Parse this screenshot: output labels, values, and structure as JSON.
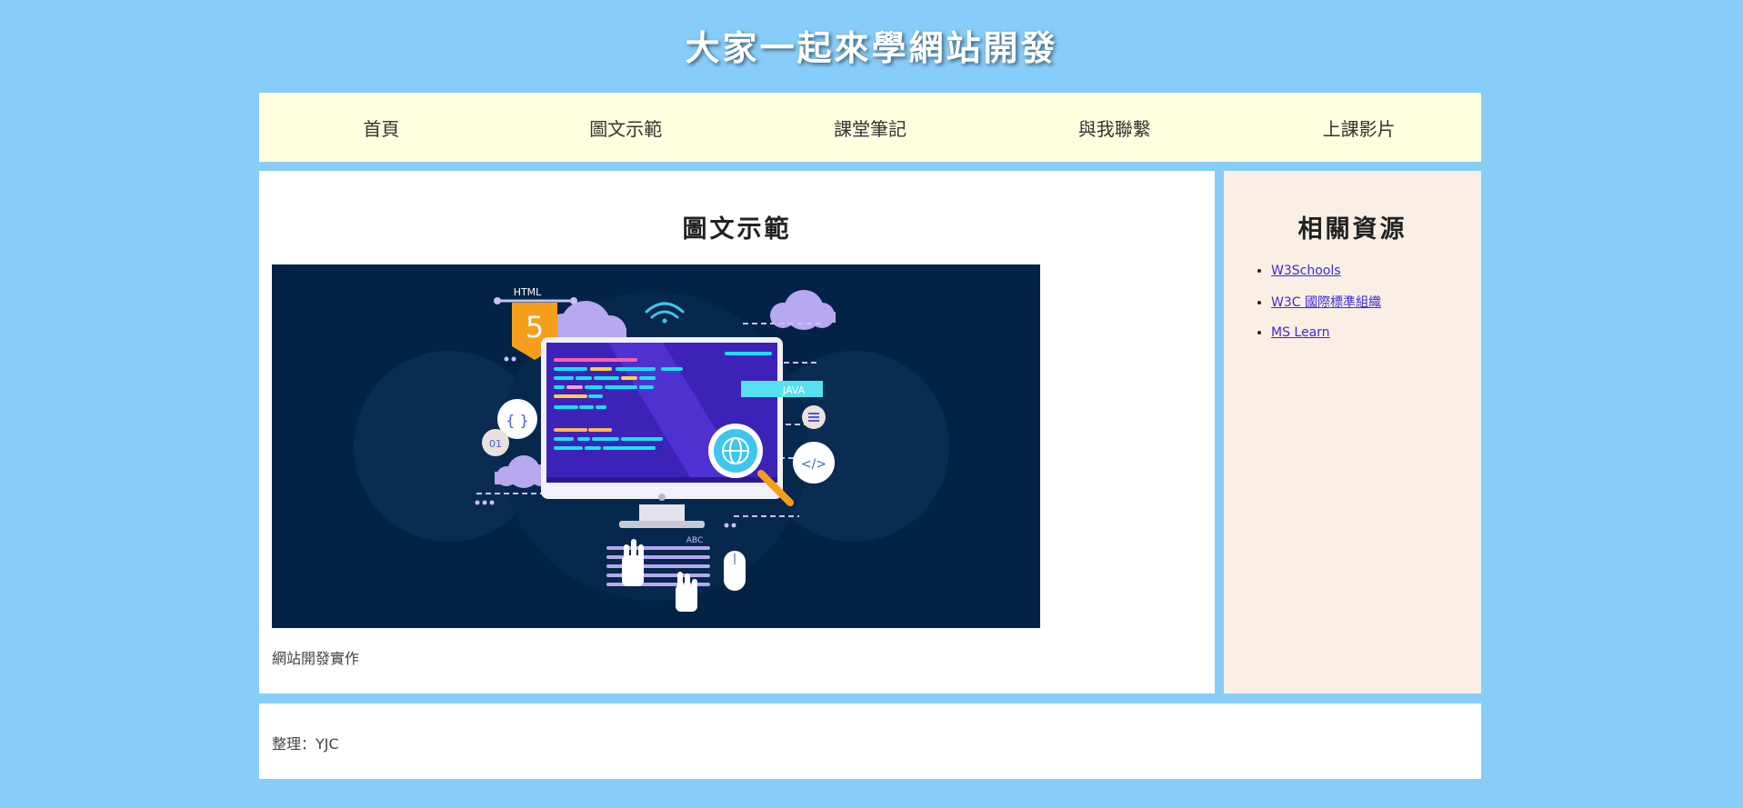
{
  "header": {
    "title": "大家一起來學網站開發"
  },
  "nav": {
    "items": [
      {
        "label": "首頁"
      },
      {
        "label": "圖文示範"
      },
      {
        "label": "課堂筆記"
      },
      {
        "label": "與我聯繫"
      },
      {
        "label": "上課影片"
      }
    ]
  },
  "main": {
    "heading": "圖文示範",
    "image": {
      "html_label": "HTML",
      "html_version": "5",
      "java_label": "JAVA",
      "abc_label": "ABC",
      "braces_label": "{ }",
      "binary_label": "01",
      "tag_label": "</>"
    },
    "caption": "網站開發實作"
  },
  "aside": {
    "heading": "相關資源",
    "links": [
      {
        "label": "W3Schools"
      },
      {
        "label": "W3C 國際標準組織"
      },
      {
        "label": "MS Learn"
      }
    ]
  },
  "footer": {
    "text": "整理：YJC"
  },
  "colors": {
    "page_background": "#87cdf9",
    "nav_background": "#ffffe0",
    "aside_background": "#faefe4",
    "hero_background": "#022346",
    "link": "#3b2bd6"
  }
}
